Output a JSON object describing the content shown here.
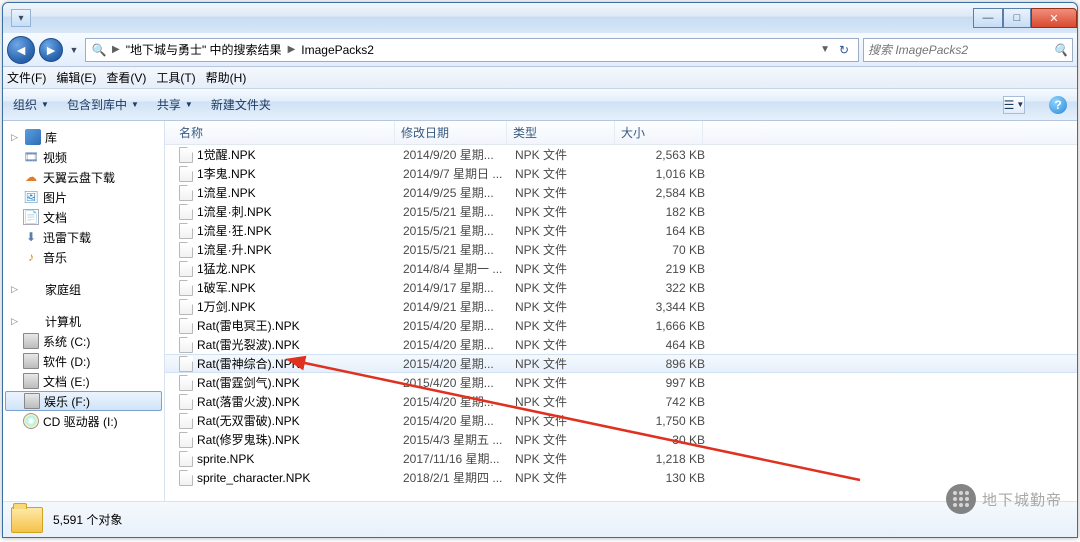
{
  "titlebar": {},
  "nav": {
    "breadcrumb_seg1": "\"地下城与勇士\" 中的搜索结果",
    "breadcrumb_seg2": "ImagePacks2",
    "search_placeholder": "搜索 ImagePacks2"
  },
  "menu": {
    "file": "文件(F)",
    "edit": "编辑(E)",
    "view": "查看(V)",
    "tools": "工具(T)",
    "help": "帮助(H)"
  },
  "toolbar": {
    "organize": "组织",
    "include": "包含到库中",
    "share": "共享",
    "newfolder": "新建文件夹"
  },
  "sidebar": {
    "groups": [
      {
        "head": "库",
        "head_icon": "ico-lib",
        "items": [
          {
            "label": "视频",
            "icon": "ico-video",
            "glyph": "🎞"
          },
          {
            "label": "天翼云盘下载",
            "icon": "ico-cloud",
            "glyph": "☁"
          },
          {
            "label": "图片",
            "icon": "ico-pic",
            "glyph": "🖼"
          },
          {
            "label": "文档",
            "icon": "ico-doc",
            "glyph": "📄"
          },
          {
            "label": "迅雷下载",
            "icon": "ico-dl",
            "glyph": "⬇"
          },
          {
            "label": "音乐",
            "icon": "ico-music",
            "glyph": "♪"
          }
        ]
      },
      {
        "head": "家庭组",
        "head_icon": "ico-home",
        "items": []
      },
      {
        "head": "计算机",
        "head_icon": "ico-pc",
        "items": [
          {
            "label": "系统 (C:)",
            "icon": "ico-drive",
            "glyph": ""
          },
          {
            "label": "软件 (D:)",
            "icon": "ico-drive",
            "glyph": ""
          },
          {
            "label": "文档 (E:)",
            "icon": "ico-drive",
            "glyph": ""
          },
          {
            "label": "娱乐 (F:)",
            "icon": "ico-drive",
            "glyph": "",
            "selected": true
          },
          {
            "label": "CD 驱动器 (I:)",
            "icon": "ico-cd",
            "glyph": ""
          }
        ]
      }
    ]
  },
  "columns": {
    "name": "名称",
    "date": "修改日期",
    "type": "类型",
    "size": "大小"
  },
  "files": [
    {
      "name": "1觉醒.NPK",
      "date": "2014/9/20 星期...",
      "type": "NPK 文件",
      "size": "2,563 KB"
    },
    {
      "name": "1李鬼.NPK",
      "date": "2014/9/7 星期日 ...",
      "type": "NPK 文件",
      "size": "1,016 KB"
    },
    {
      "name": "1流星.NPK",
      "date": "2014/9/25 星期...",
      "type": "NPK 文件",
      "size": "2,584 KB"
    },
    {
      "name": "1流星·刺.NPK",
      "date": "2015/5/21 星期...",
      "type": "NPK 文件",
      "size": "182 KB"
    },
    {
      "name": "1流星·狂.NPK",
      "date": "2015/5/21 星期...",
      "type": "NPK 文件",
      "size": "164 KB"
    },
    {
      "name": "1流星·升.NPK",
      "date": "2015/5/21 星期...",
      "type": "NPK 文件",
      "size": "70 KB"
    },
    {
      "name": "1猛龙.NPK",
      "date": "2014/8/4 星期一 ...",
      "type": "NPK 文件",
      "size": "219 KB"
    },
    {
      "name": "1破军.NPK",
      "date": "2014/9/17 星期...",
      "type": "NPK 文件",
      "size": "322 KB"
    },
    {
      "name": "1万剑.NPK",
      "date": "2014/9/21 星期...",
      "type": "NPK 文件",
      "size": "3,344 KB"
    },
    {
      "name": "Rat(雷电冥王).NPK",
      "date": "2015/4/20 星期...",
      "type": "NPK 文件",
      "size": "1,666 KB"
    },
    {
      "name": "Rat(雷光裂波).NPK",
      "date": "2015/4/20 星期...",
      "type": "NPK 文件",
      "size": "464 KB"
    },
    {
      "name": "Rat(雷神综合).NPK",
      "date": "2015/4/20 星期...",
      "type": "NPK 文件",
      "size": "896 KB",
      "highlight": true
    },
    {
      "name": "Rat(雷霆剑气).NPK",
      "date": "2015/4/20 星期...",
      "type": "NPK 文件",
      "size": "997 KB"
    },
    {
      "name": "Rat(落雷火波).NPK",
      "date": "2015/4/20 星期...",
      "type": "NPK 文件",
      "size": "742 KB"
    },
    {
      "name": "Rat(无双雷破).NPK",
      "date": "2015/4/20 星期...",
      "type": "NPK 文件",
      "size": "1,750 KB"
    },
    {
      "name": "Rat(修罗鬼珠).NPK",
      "date": "2015/4/3 星期五 ...",
      "type": "NPK 文件",
      "size": "30 KB"
    },
    {
      "name": "sprite.NPK",
      "date": "2017/11/16 星期...",
      "type": "NPK 文件",
      "size": "1,218 KB"
    },
    {
      "name": "sprite_character.NPK",
      "date": "2018/2/1 星期四 ...",
      "type": "NPK 文件",
      "size": "130 KB"
    }
  ],
  "status": {
    "count": "5,591 个对象"
  },
  "watermark": {
    "text": "地下城勤帝"
  }
}
